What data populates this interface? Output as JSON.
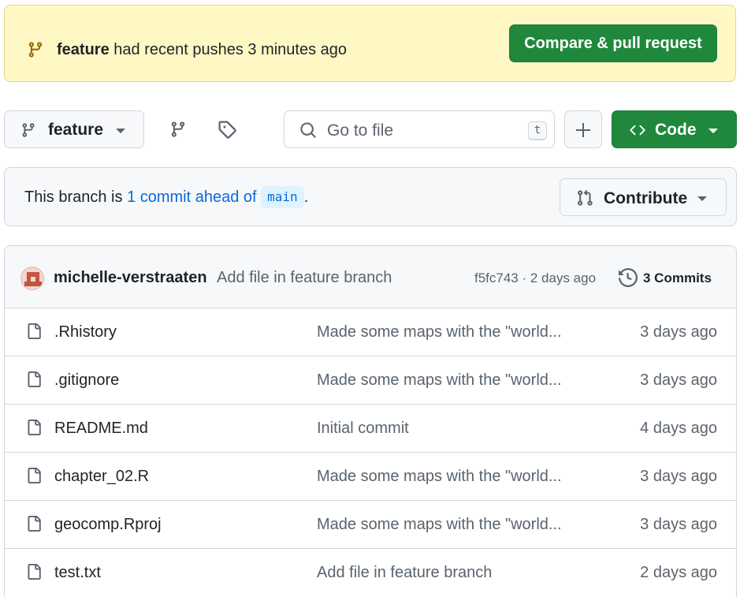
{
  "banner": {
    "branch": "feature",
    "message": "had recent pushes 3 minutes ago",
    "button": "Compare & pull request"
  },
  "toolbar": {
    "branch": "feature",
    "search_placeholder": "Go to file",
    "shortcut": "t",
    "code_label": "Code"
  },
  "ahead": {
    "prefix": "This branch is",
    "link": "1 commit ahead of",
    "base": "main",
    "suffix": ".",
    "contribute": "Contribute"
  },
  "latest_commit": {
    "author": "michelle-verstraaten",
    "message": "Add file in feature branch",
    "sha_time": "f5fc743 · 2 days ago",
    "commits": "3 Commits"
  },
  "files": [
    {
      "name": ".Rhistory",
      "message": "Made some maps with the \"world...",
      "date": "3 days ago"
    },
    {
      "name": ".gitignore",
      "message": "Made some maps with the \"world...",
      "date": "3 days ago"
    },
    {
      "name": "README.md",
      "message": "Initial commit",
      "date": "4 days ago"
    },
    {
      "name": "chapter_02.R",
      "message": "Made some maps with the \"world...",
      "date": "3 days ago"
    },
    {
      "name": "geocomp.Rproj",
      "message": "Made some maps with the \"world...",
      "date": "3 days ago"
    },
    {
      "name": "test.txt",
      "message": "Add file in feature branch",
      "date": "2 days ago"
    }
  ],
  "colors": {
    "primary_green": "#1f883d",
    "banner_bg": "#fff8c5",
    "link_blue": "#0969da",
    "muted": "#59636e"
  },
  "icons": [
    "git-branch-icon",
    "tag-icon",
    "search-icon",
    "plus-icon",
    "code-icon",
    "pull-request-icon",
    "history-icon",
    "file-icon"
  ]
}
